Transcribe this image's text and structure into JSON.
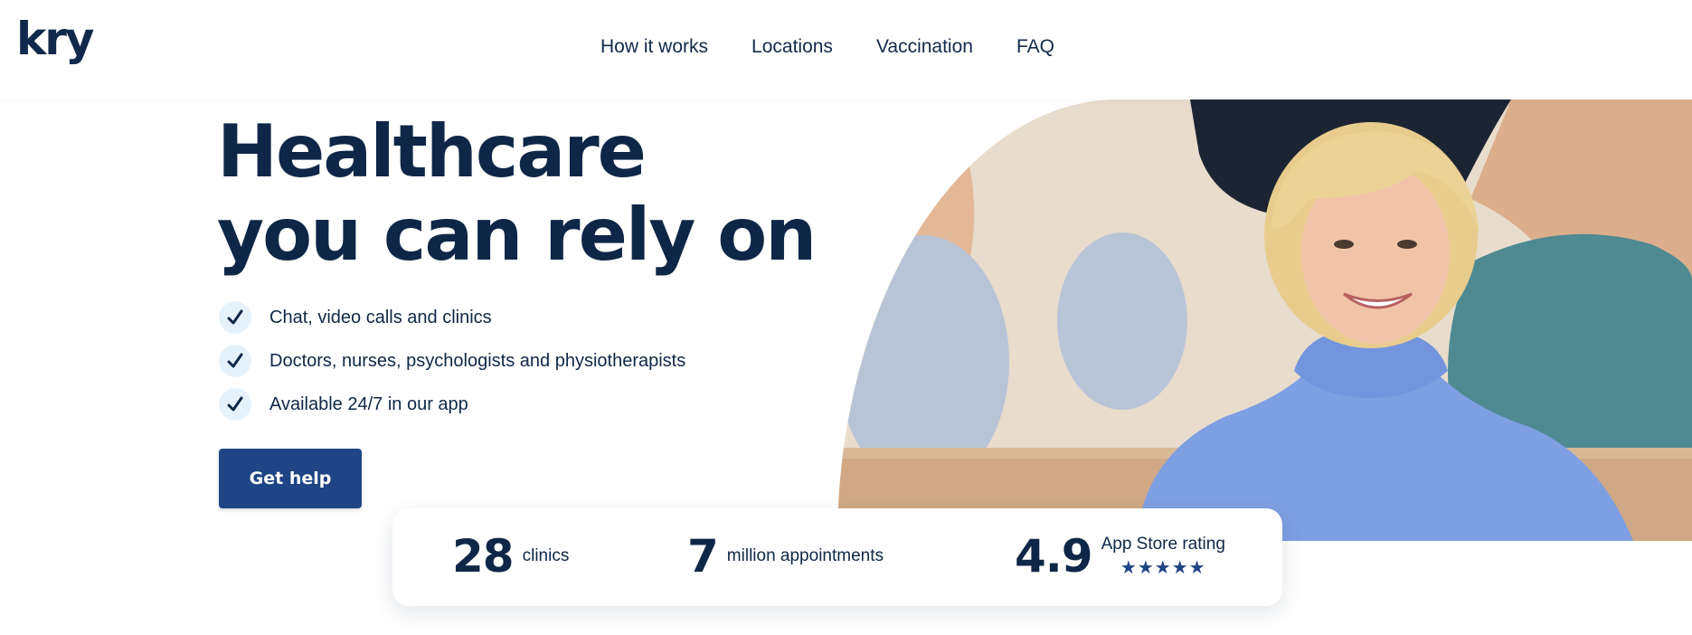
{
  "header": {
    "logo": "kry",
    "nav": [
      {
        "label": "How it works"
      },
      {
        "label": "Locations"
      },
      {
        "label": "Vaccination"
      },
      {
        "label": "FAQ"
      }
    ]
  },
  "hero": {
    "title_line1": "Healthcare",
    "title_line2": "you can rely on",
    "features": [
      {
        "text": "Chat, video calls and clinics",
        "icon": "check-icon"
      },
      {
        "text": "Doctors, nurses, psychologists and physiotherapists",
        "icon": "check-icon"
      },
      {
        "text": "Available 24/7 in our app",
        "icon": "check-icon"
      }
    ],
    "cta_label": "Get help"
  },
  "stats": [
    {
      "number": "28",
      "label": "clinics"
    },
    {
      "number": "7",
      "label": "million appointments"
    },
    {
      "number": "4.9",
      "label": "App Store rating",
      "stars": "★★★★★",
      "star_rating": 5
    }
  ],
  "colors": {
    "brand_navy": "#0f2747",
    "button_blue": "#1f4585",
    "check_bg": "#e6f2fb"
  }
}
